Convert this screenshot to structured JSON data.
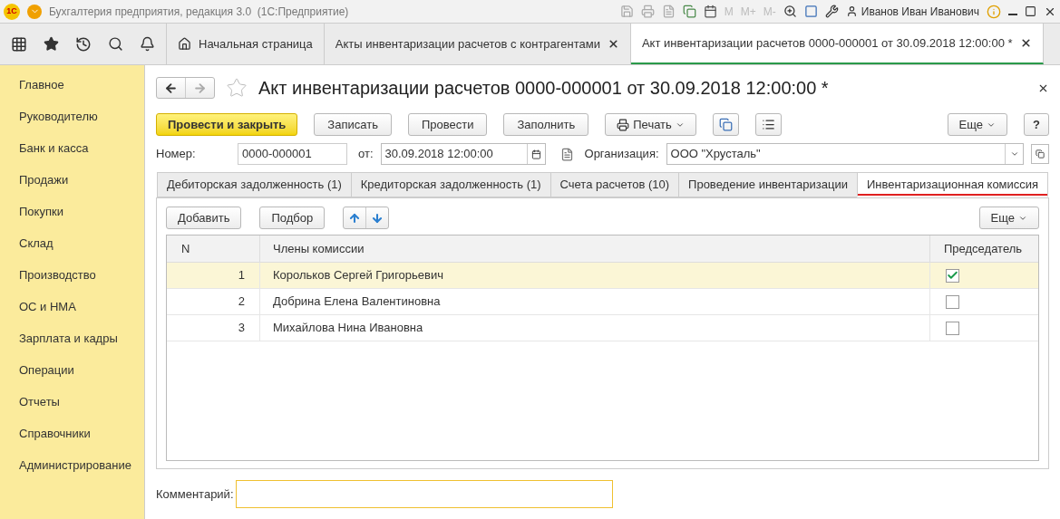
{
  "window": {
    "logo": "1С",
    "title": "Бухгалтерия предприятия, редакция 3.0  (1С:Предприятие)",
    "memory_buttons": [
      "M",
      "M+",
      "M-"
    ],
    "user": "Иванов Иван Иванович"
  },
  "top_tabs": [
    {
      "label": "Начальная страница",
      "kind": "home",
      "selected": false
    },
    {
      "label": "Акты инвентаризации расчетов с контрагентами",
      "kind": "closable",
      "selected": false
    },
    {
      "label": "Акт инвентаризации расчетов 0000-000001 от 30.09.2018 12:00:00 *",
      "kind": "closable",
      "selected": true
    }
  ],
  "sidebar": {
    "items": [
      "Главное",
      "Руководителю",
      "Банк и касса",
      "Продажи",
      "Покупки",
      "Склад",
      "Производство",
      "ОС и НМА",
      "Зарплата и кадры",
      "Операции",
      "Отчеты",
      "Справочники",
      "Администрирование"
    ]
  },
  "form": {
    "title": "Акт инвентаризации расчетов 0000-000001 от 30.09.2018 12:00:00 *",
    "toolbar": {
      "primary": "Провести и закрыть",
      "buttons": [
        "Записать",
        "Провести",
        "Заполнить"
      ],
      "print": "Печать",
      "more": "Еще",
      "help": "?"
    },
    "number_label": "Номер:",
    "number": "0000-000001",
    "date_label": "от:",
    "date": "30.09.2018 12:00:00",
    "org_label": "Организация:",
    "org": "ООО \"Хрусталь\"",
    "tabs": [
      {
        "label": "Дебиторская задолженность (1)",
        "selected": false
      },
      {
        "label": "Кредиторская задолженность (1)",
        "selected": false
      },
      {
        "label": "Счета расчетов (10)",
        "selected": false
      },
      {
        "label": "Проведение инвентаризации",
        "selected": false
      },
      {
        "label": "Инвентаризационная комиссия",
        "selected": true
      }
    ],
    "table_toolbar": {
      "buttons": [
        "Добавить",
        "Подбор"
      ],
      "more": "Еще"
    },
    "table": {
      "columns": [
        "N",
        "Члены комиссии",
        "Председатель"
      ],
      "rows": [
        {
          "n": "1",
          "name": "Корольков Сергей Григорьевич",
          "chairman": true,
          "selected": true
        },
        {
          "n": "2",
          "name": "Добрина Елена Валентиновна",
          "chairman": false,
          "selected": false
        },
        {
          "n": "3",
          "name": "Михайлова Нина Ивановна",
          "chairman": false,
          "selected": false
        }
      ]
    },
    "comment_label": "Комментарий:"
  }
}
